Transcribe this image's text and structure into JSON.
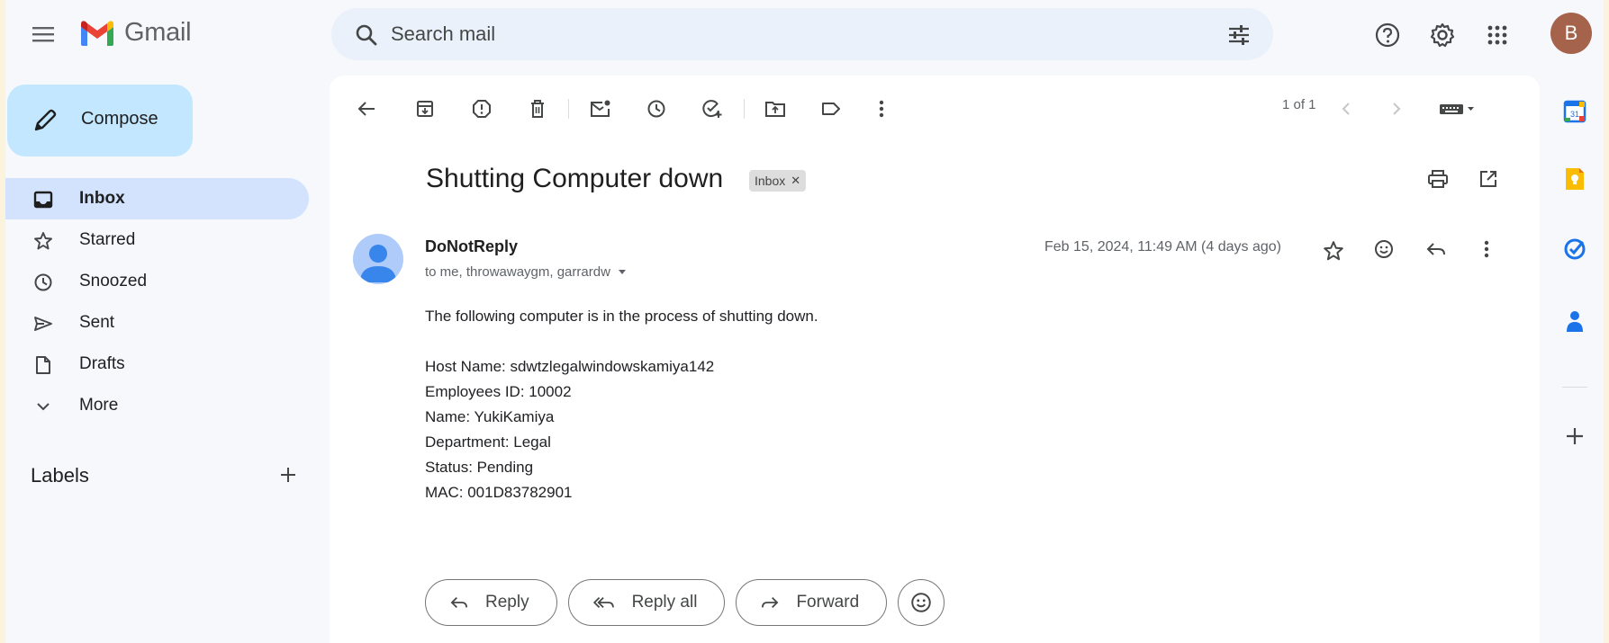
{
  "app": {
    "name": "Gmail"
  },
  "search": {
    "placeholder": "Search mail"
  },
  "account": {
    "initial": "B",
    "avatar_color": "#a4634a"
  },
  "compose": {
    "label": "Compose"
  },
  "nav": {
    "items": [
      {
        "label": "Inbox",
        "icon": "inbox-icon",
        "active": true
      },
      {
        "label": "Starred",
        "icon": "star-icon"
      },
      {
        "label": "Snoozed",
        "icon": "clock-icon"
      },
      {
        "label": "Sent",
        "icon": "send-icon"
      },
      {
        "label": "Drafts",
        "icon": "draft-icon"
      },
      {
        "label": "More",
        "icon": "chevron-down-icon"
      }
    ],
    "labels_title": "Labels"
  },
  "toolbar": {
    "pager": "1 of 1"
  },
  "message": {
    "subject": "Shutting Computer down",
    "label_chip": "Inbox",
    "sender": "DoNotReply",
    "recipients": "to me, throwawaygm, garrardw",
    "date": "Feb 15, 2024, 11:49 AM (4 days ago)",
    "body": {
      "intro": "The following computer is in the process of shutting down.",
      "host": "Host Name: sdwtzlegalwindowskamiya142",
      "employee_id": "Employees ID: 10002",
      "name": "Name: YukiKamiya",
      "department": "Department: Legal",
      "status": "Status: Pending",
      "mac": "MAC: 001D83782901"
    }
  },
  "actions": {
    "reply": "Reply",
    "reply_all": "Reply all",
    "forward": "Forward"
  },
  "colors": {
    "accent_blue": "#c2e7ff",
    "active_nav": "#d3e3fd",
    "background": "#f6f8fc"
  }
}
